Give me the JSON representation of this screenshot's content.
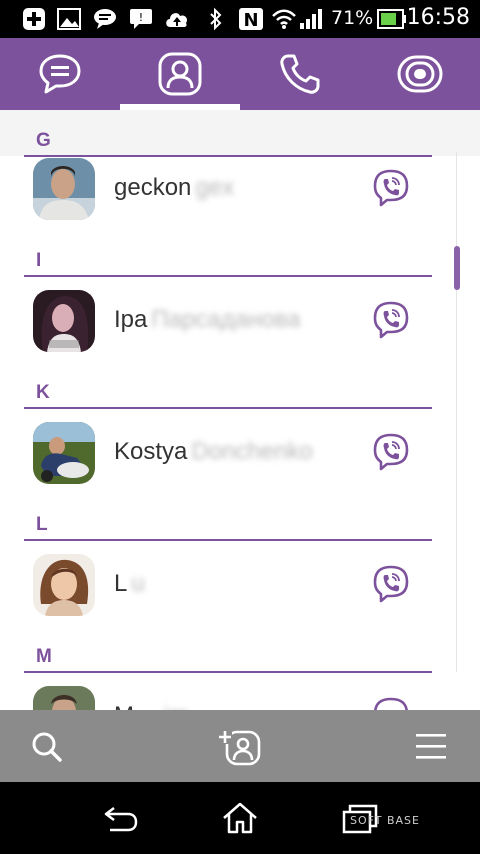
{
  "status_bar": {
    "battery_percent": "71%",
    "time": "16:58",
    "icons": [
      "plus-icon",
      "image-icon",
      "chat-notification-icon",
      "message-icon",
      "cloud-upload-icon",
      "bluetooth-icon",
      "nfc-icon",
      "wifi-icon",
      "signal-icon",
      "battery-icon"
    ]
  },
  "tabs": {
    "items": [
      {
        "icon": "chat-icon"
      },
      {
        "icon": "contacts-icon",
        "selected": true
      },
      {
        "icon": "phone-icon"
      },
      {
        "icon": "public-chats-icon"
      }
    ]
  },
  "contacts": {
    "sections": [
      {
        "letter": "G",
        "contact": {
          "first": "geckon",
          "rest": "gex"
        }
      },
      {
        "letter": "I",
        "contact": {
          "first": "Ipa",
          "rest": "Парсаданова"
        }
      },
      {
        "letter": "K",
        "contact": {
          "first": "Kostya",
          "rest": "Donchenko"
        }
      },
      {
        "letter": "L",
        "contact": {
          "first": "L",
          "rest": "u"
        }
      },
      {
        "letter": "M",
        "contact": {
          "first": "Max",
          "rest": "im"
        }
      }
    ]
  },
  "bottom_bar": {
    "buttons": [
      "search-icon",
      "add-contact-icon",
      "menu-icon"
    ]
  },
  "nav_bar": {
    "buttons": [
      "back-icon",
      "home-icon",
      "recent-apps-icon"
    ],
    "watermark": "SOFT BASE"
  },
  "colors": {
    "accent": "#7d529c",
    "bottom_bar": "#8b8b8b"
  }
}
